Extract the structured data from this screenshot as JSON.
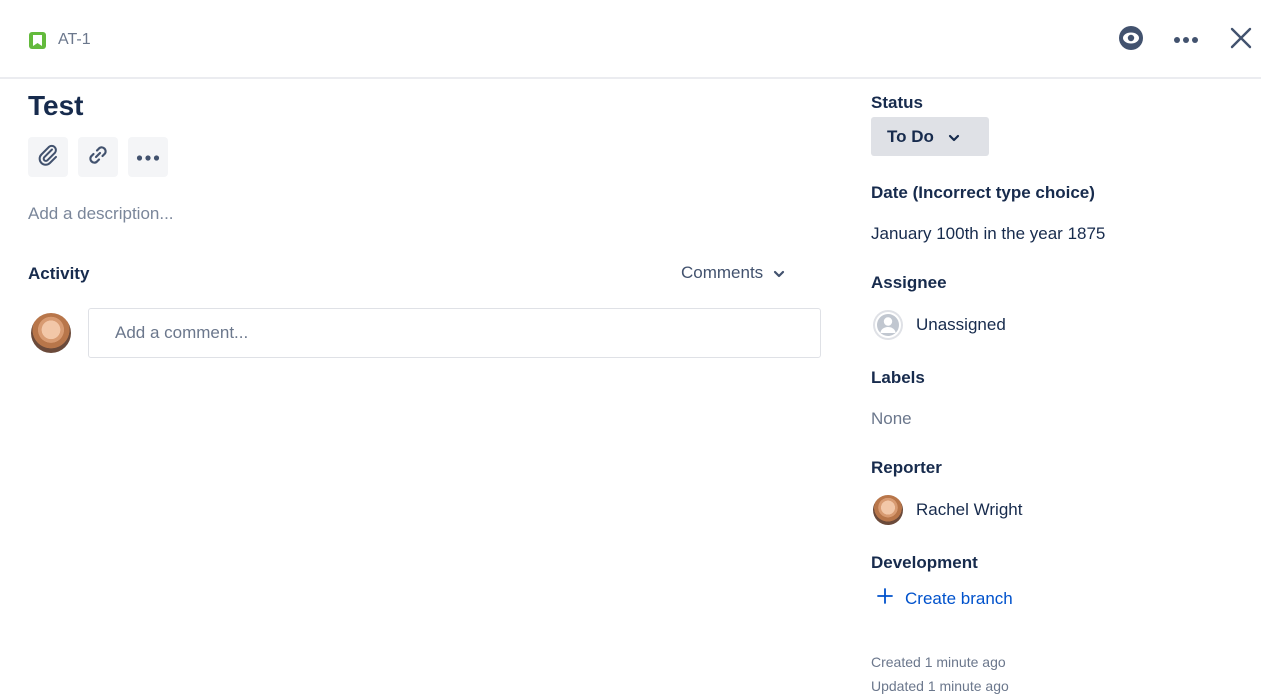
{
  "header": {
    "issue_key": "AT-1",
    "actions": [
      {
        "name": "watch-icon"
      },
      {
        "name": "more-icon"
      },
      {
        "name": "close-icon"
      }
    ]
  },
  "issue": {
    "title": "Test",
    "description_placeholder": "Add a description..."
  },
  "activity": {
    "label": "Activity",
    "filter_value": "Comments",
    "comment_placeholder": "Add a comment..."
  },
  "sidebar": {
    "status": {
      "label": "Status",
      "value": "To Do"
    },
    "date": {
      "label": "Date (Incorrect type choice)",
      "value": "January 100th in the year 1875"
    },
    "assignee": {
      "label": "Assignee",
      "value": "Unassigned"
    },
    "labels": {
      "label": "Labels",
      "value": "None"
    },
    "reporter": {
      "label": "Reporter",
      "value": "Rachel Wright"
    },
    "development": {
      "label": "Development",
      "action": "Create branch"
    },
    "created": "Created 1 minute ago",
    "updated": "Updated 1 minute ago"
  },
  "colors": {
    "accent": "#0052cc",
    "story": "#63ba3c",
    "text": "#172b4d",
    "muted": "#6b778c"
  }
}
